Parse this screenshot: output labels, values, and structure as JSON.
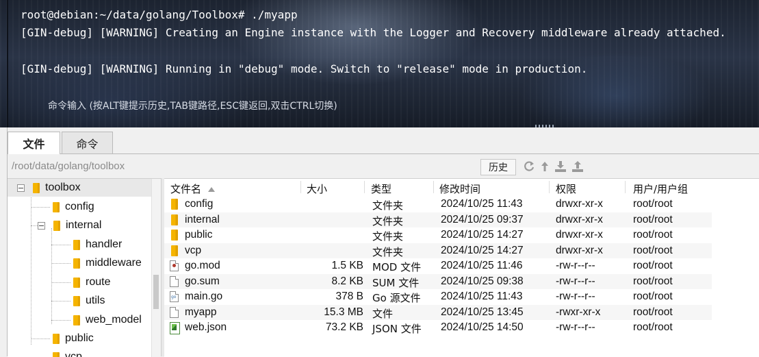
{
  "terminal": {
    "lines": [
      "root@debian:~/data/golang/Toolbox# ./myapp",
      "[GIN-debug] [WARNING] Creating an Engine instance with the Logger and Recovery middleware already attached.",
      "[GIN-debug] [WARNING] Running in \"debug\" mode. Switch to \"release\" mode in production."
    ],
    "input_hint": "命令输入 (按ALT键提示历史,TAB键路径,ESC键返回,双击CTRL切换)"
  },
  "tabs": [
    {
      "label": "文件",
      "active": true
    },
    {
      "label": "命令",
      "active": false
    }
  ],
  "pathbar": {
    "path": "/root/data/golang/toolbox",
    "history_button": "历史",
    "toolbar_icons": [
      "refresh-icon",
      "up-icon",
      "download-icon",
      "upload-icon"
    ]
  },
  "tree": {
    "items": [
      {
        "label": "toolbox",
        "expanded": true,
        "selected": true
      },
      {
        "label": "config"
      },
      {
        "label": "internal",
        "expanded": true
      },
      {
        "label": "handler"
      },
      {
        "label": "middleware"
      },
      {
        "label": "route"
      },
      {
        "label": "utils"
      },
      {
        "label": "web_model"
      },
      {
        "label": "public"
      },
      {
        "label": "vcp"
      }
    ]
  },
  "file_list": {
    "columns": [
      "文件名",
      "大小",
      "类型",
      "修改时间",
      "权限",
      "用户/用户组"
    ],
    "rows": [
      {
        "name": "config",
        "size": "",
        "type": "文件夹",
        "modified": "2024/10/25 11:43",
        "perms": "drwxr-xr-x",
        "owner": "root/root",
        "icon": "folder-icon"
      },
      {
        "name": "internal",
        "size": "",
        "type": "文件夹",
        "modified": "2024/10/25 09:37",
        "perms": "drwxr-xr-x",
        "owner": "root/root",
        "icon": "folder-icon"
      },
      {
        "name": "public",
        "size": "",
        "type": "文件夹",
        "modified": "2024/10/25 14:27",
        "perms": "drwxr-xr-x",
        "owner": "root/root",
        "icon": "folder-icon"
      },
      {
        "name": "vcp",
        "size": "",
        "type": "文件夹",
        "modified": "2024/10/25 14:27",
        "perms": "drwxr-xr-x",
        "owner": "root/root",
        "icon": "folder-icon"
      },
      {
        "name": "go.mod",
        "size": "1.5 KB",
        "type": "MOD 文件",
        "modified": "2024/10/25 11:46",
        "perms": "-rw-r--r--",
        "owner": "root/root",
        "icon": "mod-file-icon"
      },
      {
        "name": "go.sum",
        "size": "8.2 KB",
        "type": "SUM 文件",
        "modified": "2024/10/25 09:38",
        "perms": "-rw-r--r--",
        "owner": "root/root",
        "icon": "file-icon"
      },
      {
        "name": "main.go",
        "size": "378 B",
        "type": "Go 源文件",
        "modified": "2024/10/25 11:43",
        "perms": "-rw-r--r--",
        "owner": "root/root",
        "icon": "go-file-icon"
      },
      {
        "name": "myapp",
        "size": "15.3 MB",
        "type": "文件",
        "modified": "2024/10/25 13:45",
        "perms": "-rwxr-xr-x",
        "owner": "root/root",
        "icon": "file-icon"
      },
      {
        "name": "web.json",
        "size": "73.2 KB",
        "type": "JSON 文件",
        "modified": "2024/10/25 14:50",
        "perms": "-rw-r--r--",
        "owner": "root/root",
        "icon": "json-file-icon"
      }
    ]
  }
}
